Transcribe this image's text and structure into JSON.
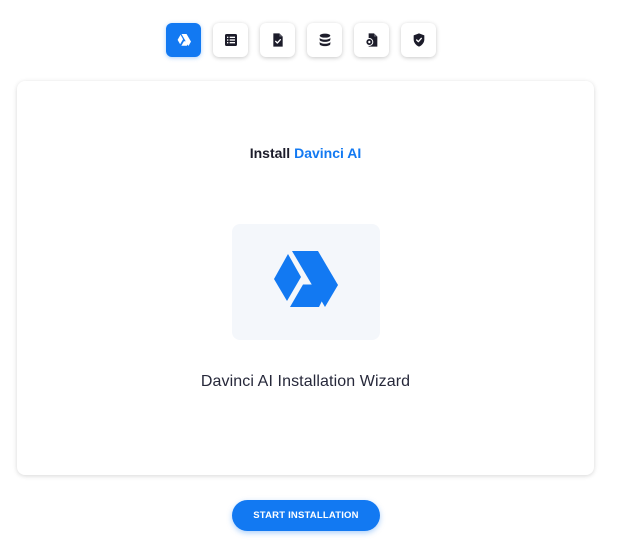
{
  "steps": [
    {
      "icon": "drive-icon",
      "active": true
    },
    {
      "icon": "list-icon",
      "active": false
    },
    {
      "icon": "file-check-icon",
      "active": false
    },
    {
      "icon": "database-icon",
      "active": false
    },
    {
      "icon": "file-settings-icon",
      "active": false
    },
    {
      "icon": "shield-check-icon",
      "active": false
    }
  ],
  "card": {
    "heading_prefix": "Install",
    "heading_accent": "Davinci AI",
    "logo_icon": "drive-icon",
    "wizard_title": "Davinci AI Installation Wizard"
  },
  "actions": {
    "start_label": "START INSTALLATION"
  },
  "colors": {
    "accent": "#1279f2",
    "text": "#1c1c2a",
    "logo_bg": "#f4f7fb"
  }
}
